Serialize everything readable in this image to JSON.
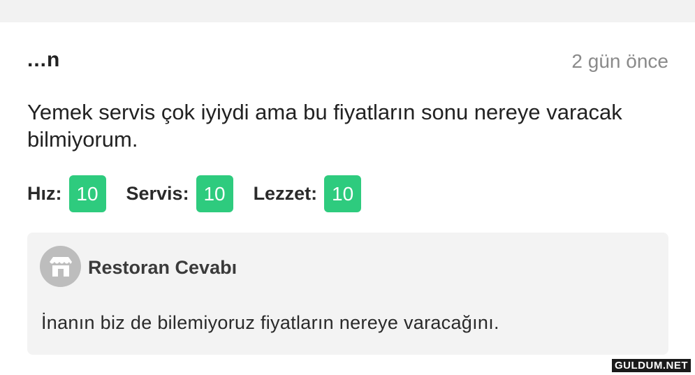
{
  "review": {
    "username": "...n",
    "timestamp": "2 gün önce",
    "comment": "Yemek servis çok iyiydi ama bu fiyatların sonu nereye varacak bilmiyorum.",
    "ratings": [
      {
        "label": "Hız:",
        "score": "10"
      },
      {
        "label": "Servis:",
        "score": "10"
      },
      {
        "label": "Lezzet:",
        "score": "10"
      }
    ]
  },
  "reply": {
    "title": "Restoran Cevabı",
    "avatar_icon": "storefront-icon",
    "text": "İnanın biz de bilemiyoruz fiyatların nereye varacağını."
  },
  "watermark": "GULDUM.NET",
  "colors": {
    "badge": "#2ecb7e",
    "reply_background": "#f3f3f3",
    "timestamp": "#8a8a8a"
  }
}
